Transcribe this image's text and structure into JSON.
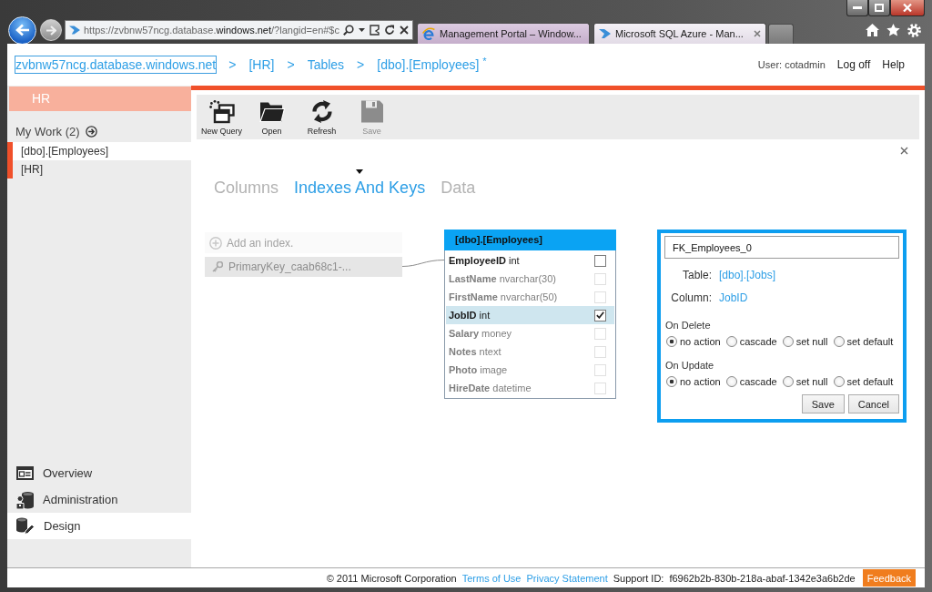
{
  "browser": {
    "address": {
      "start": "https://zvbnw57ncg.database.",
      "domain": "windows.net",
      "end": "/?langid=en#$c"
    },
    "tabs": [
      {
        "title": "Management Portal – Window...",
        "selected": false
      },
      {
        "title": "Microsoft SQL Azure - Man...",
        "selected": true
      }
    ]
  },
  "header": {
    "breadcrumb": [
      {
        "kind": "link",
        "label": "zvbnw57ncg.database.windows.net",
        "focused": true
      },
      {
        "kind": "separator",
        "label": ">",
        "focused": false
      },
      {
        "kind": "link",
        "label": "[HR]",
        "focused": false
      },
      {
        "kind": "separator",
        "label": ">",
        "focused": false
      },
      {
        "kind": "link",
        "label": "Tables",
        "focused": false
      },
      {
        "kind": "separator",
        "label": ">",
        "focused": false
      },
      {
        "kind": "link",
        "label": "[dbo].[Employees]",
        "focused": false
      },
      {
        "kind": "mark",
        "label": "*",
        "focused": false
      }
    ],
    "user": "User: cotadmin",
    "links": [
      "Log off",
      "Help"
    ]
  },
  "sidebar": {
    "section": "HR",
    "my_work": {
      "label": "My Work (2)",
      "items": [
        {
          "label": "[dbo].[Employees]",
          "selected": true
        },
        {
          "label": "[HR]",
          "selected": false
        }
      ]
    },
    "nav": [
      {
        "label": "Overview",
        "selected": false
      },
      {
        "label": "Administration",
        "selected": false
      },
      {
        "label": "Design",
        "selected": true
      }
    ]
  },
  "toolbar": [
    {
      "label": "New Query",
      "disabled": false
    },
    {
      "label": "Open",
      "disabled": false
    },
    {
      "label": "Refresh",
      "disabled": false
    },
    {
      "label": "Save",
      "disabled": true
    }
  ],
  "tabs": [
    {
      "label": "Columns",
      "selected": false
    },
    {
      "label": "Indexes And Keys",
      "selected": true
    },
    {
      "label": "Data",
      "selected": false
    }
  ],
  "indexes": {
    "add_label": "Add an index.",
    "items": [
      {
        "name": "PrimaryKey_caab68c1-..."
      }
    ]
  },
  "table": {
    "title": "[dbo].[Employees]",
    "columns": [
      {
        "name": "EmployeeID",
        "type": "int",
        "disabled": false,
        "selected": false,
        "checked": false
      },
      {
        "name": "LastName",
        "type": "nvarchar(30)",
        "disabled": true,
        "selected": false,
        "checked": false
      },
      {
        "name": "FirstName",
        "type": "nvarchar(50)",
        "disabled": true,
        "selected": false,
        "checked": false
      },
      {
        "name": "JobID",
        "type": "int",
        "disabled": false,
        "selected": true,
        "checked": true
      },
      {
        "name": "Salary",
        "type": "money",
        "disabled": true,
        "selected": false,
        "checked": false
      },
      {
        "name": "Notes",
        "type": "ntext",
        "disabled": true,
        "selected": false,
        "checked": false
      },
      {
        "name": "Photo",
        "type": "image",
        "disabled": true,
        "selected": false,
        "checked": false
      },
      {
        "name": "HireDate",
        "type": "datetime",
        "disabled": true,
        "selected": false,
        "checked": false
      }
    ]
  },
  "foreign_key": {
    "name": "FK_Employees_0",
    "table_label": "Table:",
    "table": "[dbo].[Jobs]",
    "column_label": "Column:",
    "column": "JobID",
    "on_delete": {
      "label": "On Delete",
      "options": [
        {
          "label": "no action",
          "selected": true
        },
        {
          "label": "cascade",
          "selected": false
        },
        {
          "label": "set null",
          "selected": false
        },
        {
          "label": "set default",
          "selected": false
        }
      ]
    },
    "on_update": {
      "label": "On Update",
      "options": [
        {
          "label": "no action",
          "selected": true
        },
        {
          "label": "cascade",
          "selected": false
        },
        {
          "label": "set null",
          "selected": false
        },
        {
          "label": "set default",
          "selected": false
        }
      ]
    },
    "buttons": [
      "Save",
      "Cancel"
    ]
  },
  "footer": {
    "copyright": "© 2011 Microsoft Corporation",
    "links": [
      "Terms of Use",
      "Privacy Statement"
    ],
    "support_label": "Support ID:",
    "support_id": "f6962b2b-830b-218a-abaf-1342e3a6b2de",
    "feedback": "Feedback"
  }
}
